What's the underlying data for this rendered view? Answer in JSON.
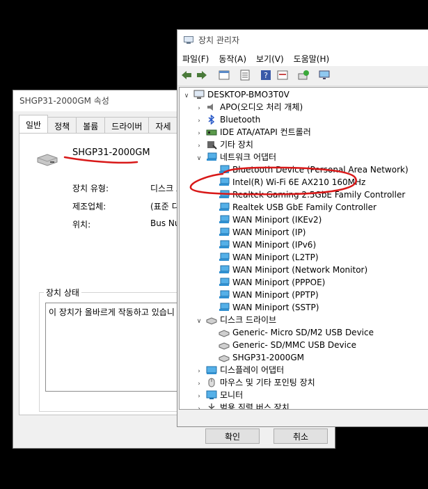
{
  "props": {
    "title": "SHGP31-2000GM 속성",
    "tabs": [
      "일반",
      "정책",
      "볼륨",
      "드라이버",
      "자세"
    ],
    "device_name": "SHGP31-2000GM",
    "fields": [
      {
        "label": "장치 유형:",
        "value": "디스크 드"
      },
      {
        "label": "제조업체:",
        "value": "(표준 디스"
      },
      {
        "label": "위치:",
        "value": "Bus Num"
      }
    ],
    "status_group": "장치 상태",
    "status_text": "이 장치가 올바르게 작동하고 있습니",
    "ok_label": "확인",
    "cancel_label": "취소"
  },
  "devmgr": {
    "title": "장치 관리자",
    "menus": [
      "파일(F)",
      "동작(A)",
      "보기(V)",
      "도움말(H)"
    ],
    "root": "DESKTOP-BMO3T0V",
    "tree": [
      {
        "label": "APO(오디오 처리 개체)",
        "level": 1,
        "expander": "right",
        "icon": "speaker-icon"
      },
      {
        "label": "Bluetooth",
        "level": 1,
        "expander": "right",
        "icon": "bluetooth-icon"
      },
      {
        "label": "IDE ATA/ATAPI 컨트롤러",
        "level": 1,
        "expander": "right",
        "icon": "controller-icon"
      },
      {
        "label": "기타 장치",
        "level": 1,
        "expander": "right",
        "icon": "unknown-device-icon"
      },
      {
        "label": "네트워크 어댑터",
        "level": 1,
        "expander": "down",
        "icon": "network-icon"
      },
      {
        "label": "Bluetooth Device (Personal Area Network)",
        "level": 2,
        "icon": "network-icon"
      },
      {
        "label": "Intel(R) Wi-Fi 6E AX210 160MHz",
        "level": 2,
        "icon": "network-icon"
      },
      {
        "label": "Realtek Gaming 2.5GbE Family Controller",
        "level": 2,
        "icon": "network-icon"
      },
      {
        "label": "Realtek USB GbE Family Controller",
        "level": 2,
        "icon": "network-icon"
      },
      {
        "label": "WAN Miniport (IKEv2)",
        "level": 2,
        "icon": "network-icon"
      },
      {
        "label": "WAN Miniport (IP)",
        "level": 2,
        "icon": "network-icon"
      },
      {
        "label": "WAN Miniport (IPv6)",
        "level": 2,
        "icon": "network-icon"
      },
      {
        "label": "WAN Miniport (L2TP)",
        "level": 2,
        "icon": "network-icon"
      },
      {
        "label": "WAN Miniport (Network Monitor)",
        "level": 2,
        "icon": "network-icon"
      },
      {
        "label": "WAN Miniport (PPPOE)",
        "level": 2,
        "icon": "network-icon"
      },
      {
        "label": "WAN Miniport (PPTP)",
        "level": 2,
        "icon": "network-icon"
      },
      {
        "label": "WAN Miniport (SSTP)",
        "level": 2,
        "icon": "network-icon"
      },
      {
        "label": "디스크 드라이브",
        "level": 1,
        "expander": "down",
        "icon": "disk-icon"
      },
      {
        "label": "Generic- Micro SD/M2 USB Device",
        "level": 2,
        "icon": "disk-icon"
      },
      {
        "label": "Generic- SD/MMC USB Device",
        "level": 2,
        "icon": "disk-icon"
      },
      {
        "label": "SHGP31-2000GM",
        "level": 2,
        "icon": "disk-icon"
      },
      {
        "label": "디스플레이 어댑터",
        "level": 1,
        "expander": "right",
        "icon": "display-icon"
      },
      {
        "label": "마우스 및 기타 포인팅 장치",
        "level": 1,
        "expander": "right",
        "icon": "mouse-icon"
      },
      {
        "label": "모니터",
        "level": 1,
        "expander": "right",
        "icon": "monitor-icon"
      },
      {
        "label": "범용 직렬 버스 장치",
        "level": 1,
        "expander": "right",
        "icon": "usb-icon"
      }
    ]
  },
  "colors": {
    "annotation": "#d81818",
    "net_icon": "#2f8fd0"
  }
}
